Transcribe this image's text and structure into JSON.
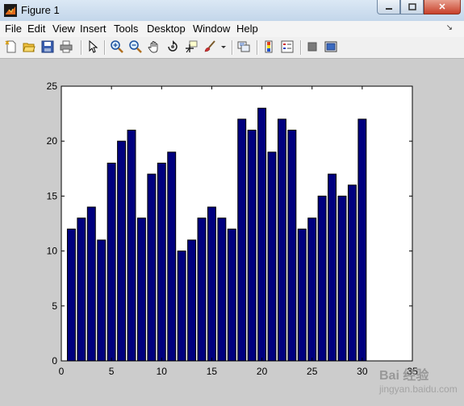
{
  "window": {
    "title": "Figure 1"
  },
  "menu": [
    "File",
    "Edit",
    "View",
    "Insert",
    "Tools",
    "Desktop",
    "Window",
    "Help"
  ],
  "toolbar": [
    "new-figure-icon",
    "open-file-icon",
    "save-icon",
    "print-icon",
    "pointer-icon",
    "zoom-in-icon",
    "zoom-out-icon",
    "pan-icon",
    "rotate-3d-icon",
    "data-cursor-icon",
    "brush-icon",
    "link-plot-icon",
    "colorbar-icon",
    "legend-icon",
    "hide-plot-tools-icon",
    "show-plot-tools-icon"
  ],
  "watermark": {
    "brand": "Bai 经验",
    "url": "jingyan.baidu.com"
  },
  "chart_data": {
    "type": "bar",
    "x": [
      1,
      2,
      3,
      4,
      5,
      6,
      7,
      8,
      9,
      10,
      11,
      12,
      13,
      14,
      15,
      16,
      17,
      18,
      19,
      20,
      21,
      22,
      23,
      24,
      25,
      26,
      27,
      28,
      29,
      30
    ],
    "values": [
      12,
      13,
      14,
      11,
      18,
      20,
      21,
      13,
      17,
      18,
      19,
      10,
      11,
      13,
      14,
      13,
      12,
      22,
      21,
      23,
      19,
      22,
      21,
      12,
      13,
      15,
      17,
      15,
      16,
      22
    ],
    "xlim": [
      0,
      35
    ],
    "ylim": [
      0,
      25
    ],
    "xticks": [
      0,
      5,
      10,
      15,
      20,
      25,
      30,
      35
    ],
    "yticks": [
      0,
      5,
      10,
      15,
      20,
      25
    ],
    "bar_color": "#00007f",
    "title": "",
    "xlabel": "",
    "ylabel": "",
    "grid": false
  }
}
